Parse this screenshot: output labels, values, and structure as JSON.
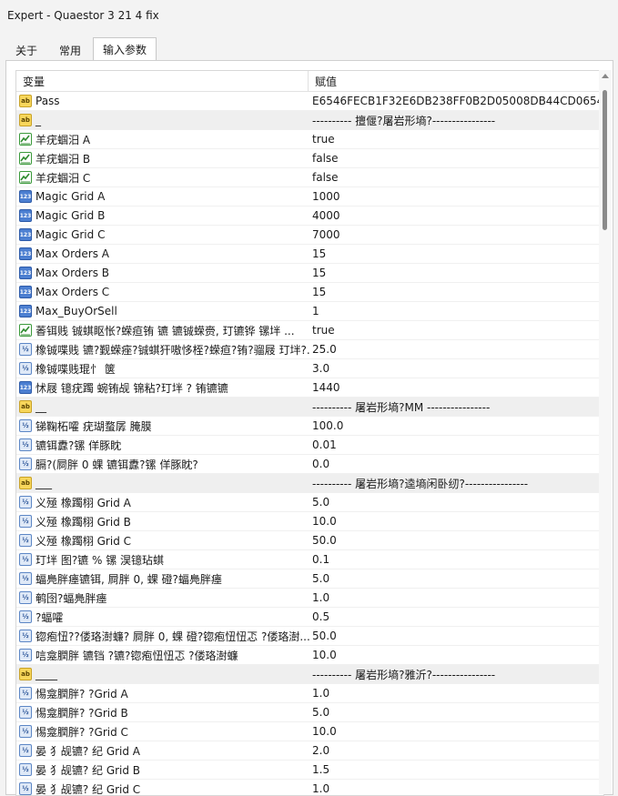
{
  "window": {
    "title": "Expert - Quaestor 3 21 4 fix"
  },
  "tabs": [
    "关于",
    "常用",
    "输入参数"
  ],
  "table": {
    "headers": {
      "variable": "变量",
      "value": "赋值"
    },
    "rows": [
      {
        "icon": "ab",
        "name": "Pass",
        "value": "E6546FECB1F32E6DB238FF0B2D05008DB44CD0654...",
        "sep": false
      },
      {
        "icon": "ab",
        "name": "_",
        "value": "---------- 擅偃?屠岩形墒?----------------",
        "sep": true
      },
      {
        "icon": "bool",
        "name": "羊疣蝈汨    A",
        "value": "true",
        "sep": false
      },
      {
        "icon": "bool",
        "name": "羊疣蝈汨    B",
        "value": "false",
        "sep": false
      },
      {
        "icon": "bool",
        "name": "羊疣蝈汨    C",
        "value": "false",
        "sep": false
      },
      {
        "icon": "123",
        "name": "Magic Grid A",
        "value": "1000",
        "sep": false
      },
      {
        "icon": "123",
        "name": "Magic Grid B",
        "value": "4000",
        "sep": false
      },
      {
        "icon": "123",
        "name": "Magic Grid C",
        "value": "7000",
        "sep": false
      },
      {
        "icon": "123",
        "name": "Max Orders A",
        "value": "15",
        "sep": false
      },
      {
        "icon": "123",
        "name": "Max Orders B",
        "value": "15",
        "sep": false
      },
      {
        "icon": "123",
        "name": "Max Orders C",
        "value": "15",
        "sep": false
      },
      {
        "icon": "123",
        "name": "Max_BuyOrSell",
        "value": "1",
        "sep": false
      },
      {
        "icon": "bool",
        "name": "萫铒贱 铖蜞眍怅?蝾疸铕 镳 镳铖蝾赍, 玎镳铧 镙坢   ...",
        "value": "true",
        "sep": false
      },
      {
        "icon": "flt",
        "name": "橡铖喋贱 镳?觐蝾痤?铖蜞犴嗷恀桎?蝾疸?铕?骝屐 玎坢?...",
        "value": "25.0",
        "sep": false
      },
      {
        "icon": "flt",
        "name": "橡铖喋贱琨忄 箧",
        "value": "3.0",
        "sep": false
      },
      {
        "icon": "123",
        "name": "怵屐    镱疣躅    蜿铕觇  锦粘?玎坢    ? 铕镳镳",
        "value": "1440",
        "sep": false
      },
      {
        "icon": "ab",
        "name": "__",
        "value": "---------- 屠岩形墒?MM ----------------",
        "sep": true
      },
      {
        "icon": "flt",
        "name": "锑鞠柘嚯       疣瑚蝥孱 腌膜",
        "value": "100.0",
        "sep": false
      },
      {
        "icon": "flt",
        "name": "镳铒纛?镙 佯豚眈",
        "value": "0.01",
        "sep": false
      },
      {
        "icon": "flt",
        "name": "膈?(屙胖 0 蜾 镳铒纛?镙 佯豚眈?",
        "value": "0.0",
        "sep": false
      },
      {
        "icon": "ab",
        "name": "___",
        "value": "---------- 屠岩形墒?逵墒闲卧纫?----------------",
        "sep": true
      },
      {
        "icon": "flt",
        "name": "义殛 橡躅栩 Grid A",
        "value": "5.0",
        "sep": false
      },
      {
        "icon": "flt",
        "name": "义殛 橡躅栩 Grid B",
        "value": "10.0",
        "sep": false
      },
      {
        "icon": "flt",
        "name": "义殛 橡躅栩 Grid C",
        "value": "50.0",
        "sep": false
      },
      {
        "icon": "flt",
        "name": "玎坢    图?镳 % 镙 淏镱玷蜞",
        "value": "0.1",
        "sep": false
      },
      {
        "icon": "flt",
        "name": "蝠鳧胖瘗镳铒, 屙胖 0, 蜾 磴?蝠鳧胖瘗",
        "value": "5.0",
        "sep": false
      },
      {
        "icon": "flt",
        "name": "鹌囹?蝠鳧胖瘗",
        "value": "1.0",
        "sep": false
      },
      {
        "icon": "flt",
        "name": "  ?蝠嚯",
        "value": "0.5",
        "sep": false
      },
      {
        "icon": "flt",
        "name": "锪疱忸??偻珞澍蠊? 屙胖 0, 蜾 磴?锪疱忸忸忑 ?偻珞澍...",
        "value": "50.0",
        "sep": false
      },
      {
        "icon": "flt",
        "name": "唁龛膶胖    镳铛 ?镳?锪疱忸忸忑 ?偻珞澍蠊",
        "value": "10.0",
        "sep": false
      },
      {
        "icon": "ab",
        "name": "____",
        "value": "---------- 屠岩形墒?雅沂?----------------",
        "sep": true
      },
      {
        "icon": "flt",
        "name": "惕龛膶胖?   ?Grid A",
        "value": "1.0",
        "sep": false
      },
      {
        "icon": "flt",
        "name": "惕龛膶胖?   ?Grid B",
        "value": "5.0",
        "sep": false
      },
      {
        "icon": "flt",
        "name": "惕龛膶胖?   ?Grid C",
        "value": "10.0",
        "sep": false
      },
      {
        "icon": "flt",
        "name": "晏    犭觇镳?    纪 Grid A",
        "value": "2.0",
        "sep": false
      },
      {
        "icon": "flt",
        "name": "晏    犭觇镳?    纪 Grid B",
        "value": "1.5",
        "sep": false
      },
      {
        "icon": "flt",
        "name": "晏    犭觇镳?    纪 Grid C",
        "value": "1.0",
        "sep": false
      }
    ]
  },
  "icons": {
    "ab": "string-type-icon",
    "bool": "boolean-type-icon",
    "123": "integer-type-icon",
    "flt": "double-type-icon"
  },
  "icon_labels": {
    "ab": "ab",
    "123": "123",
    "flt": "½"
  }
}
